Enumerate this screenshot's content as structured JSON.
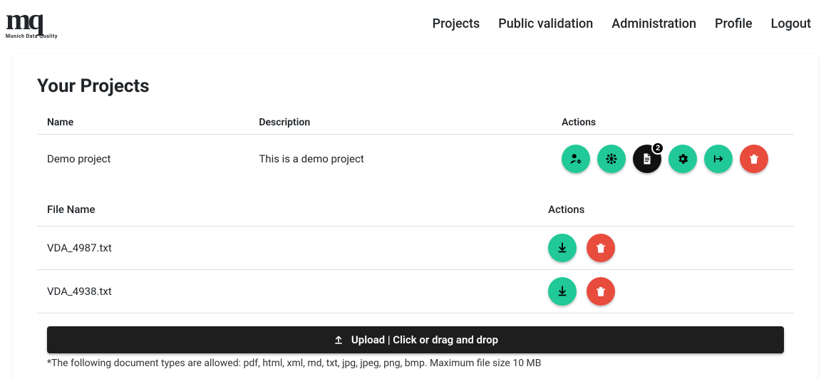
{
  "logo": {
    "main": "mq",
    "sub": "Munich Data Quality"
  },
  "nav": [
    "Projects",
    "Public validation",
    "Administration",
    "Profile",
    "Logout"
  ],
  "section_title": "Your Projects",
  "table": {
    "headers": {
      "name": "Name",
      "description": "Description",
      "actions": "Actions"
    },
    "row": {
      "name": "Demo project",
      "description": "This is a demo project",
      "badge": "2"
    }
  },
  "files": {
    "headers": {
      "name": "File Name",
      "actions": "Actions"
    },
    "rows": [
      {
        "name": "VDA_4987.txt"
      },
      {
        "name": "VDA_4938.txt"
      }
    ]
  },
  "upload_label": "Upload | Click or drag and drop",
  "hint": "*The following document types are allowed: pdf, html, xml, md, txt, jpg, jpeg, png, bmp. Maximum file size 10 MB",
  "colors": {
    "teal": "#20c997",
    "red": "#e84c3d",
    "black": "#111111"
  }
}
